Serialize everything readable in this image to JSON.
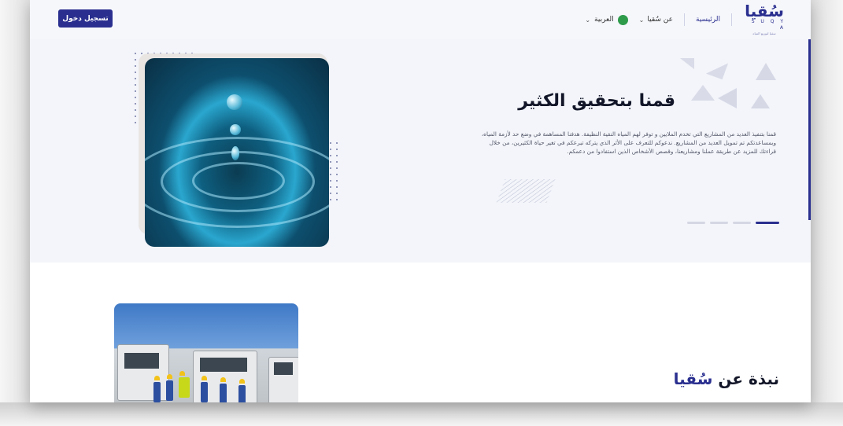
{
  "navbar": {
    "login_label": "تسجيل دخول",
    "home_label": "الرئيسية",
    "about_label": "عن سُقيا",
    "language_label": "العربية",
    "logo_ar": "سُقيا",
    "logo_en": "S U Q Y A",
    "logo_tagline": "سقيا لتوزيع المياه"
  },
  "hero": {
    "title": "قمنا بتحقيق الكثير",
    "paragraph": "قمنا بتنفيذ العديد من المشاريع التي تخدم الملايين و توفر لهم المياه النقية النظيفة. هدفنا المساهمة في وضع حد لأزمة المياه، وبمساعدتكم تم تمويل العديد من المشاريع. ندعوكم للتعرف على الأثر الذي يتركه تبرعكم في تغير حياة الكثيرين، من خلال قراءتك للمزيد عن طريقة عملنا ومشاريعنا، وقصص الأشخاص الذين استفادوا من دعمكم."
  },
  "pager": {
    "count": 4,
    "active_index": 0
  },
  "about": {
    "title_prefix": "نبذة عن",
    "title_accent": "سُقيا"
  },
  "colors": {
    "brand": "#2a2f8f",
    "hero_bg": "#f3f5fa",
    "text_dark": "#121628",
    "text_muted": "#55586a"
  }
}
